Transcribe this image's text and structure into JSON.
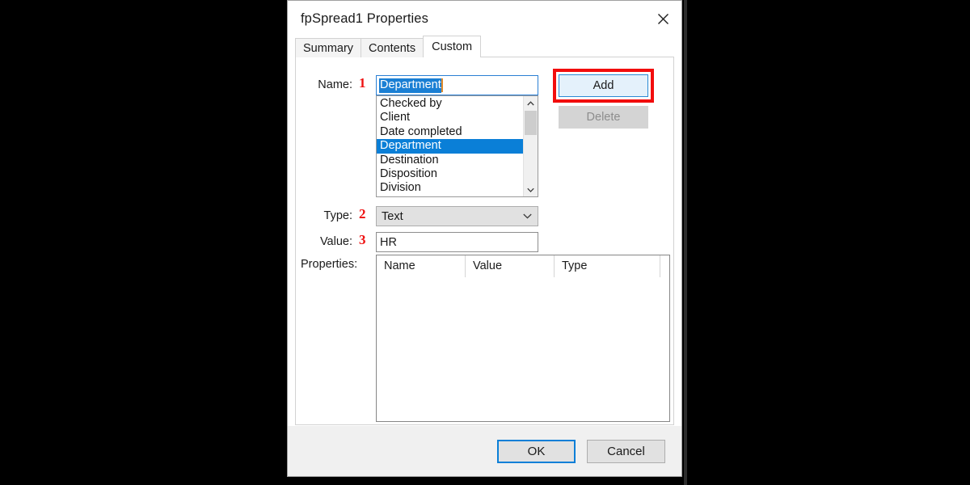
{
  "window": {
    "title": "fpSpread1 Properties",
    "close_icon": "close-icon"
  },
  "tabs": [
    {
      "label": "Summary",
      "active": false
    },
    {
      "label": "Contents",
      "active": false
    },
    {
      "label": "Custom",
      "active": true
    }
  ],
  "form": {
    "name_label": "Name:",
    "name_value": "Department",
    "name_step": "1",
    "type_label": "Type:",
    "type_value": "Text",
    "type_step": "2",
    "value_label": "Value:",
    "value_value": "HR",
    "value_step": "3",
    "properties_label": "Properties:"
  },
  "name_list": {
    "items": [
      {
        "label": "Checked by",
        "selected": false
      },
      {
        "label": "Client",
        "selected": false
      },
      {
        "label": "Date completed",
        "selected": false
      },
      {
        "label": "Department",
        "selected": true
      },
      {
        "label": "Destination",
        "selected": false
      },
      {
        "label": "Disposition",
        "selected": false
      },
      {
        "label": "Division",
        "selected": false
      }
    ],
    "scroll_up_icon": "chevron-up-icon",
    "scroll_down_icon": "chevron-down-icon"
  },
  "side_buttons": {
    "add_label": "Add",
    "delete_label": "Delete",
    "delete_disabled": true,
    "add_highlighted": true
  },
  "properties_table": {
    "columns": [
      "Name",
      "Value",
      "Type"
    ],
    "rows": []
  },
  "footer": {
    "ok_label": "OK",
    "cancel_label": "Cancel"
  },
  "colors": {
    "accent_blue": "#0a7fd7",
    "annotation_red": "#f20d0d",
    "add_button_fill": "#e4f1fb",
    "backdrop": "#000000"
  }
}
